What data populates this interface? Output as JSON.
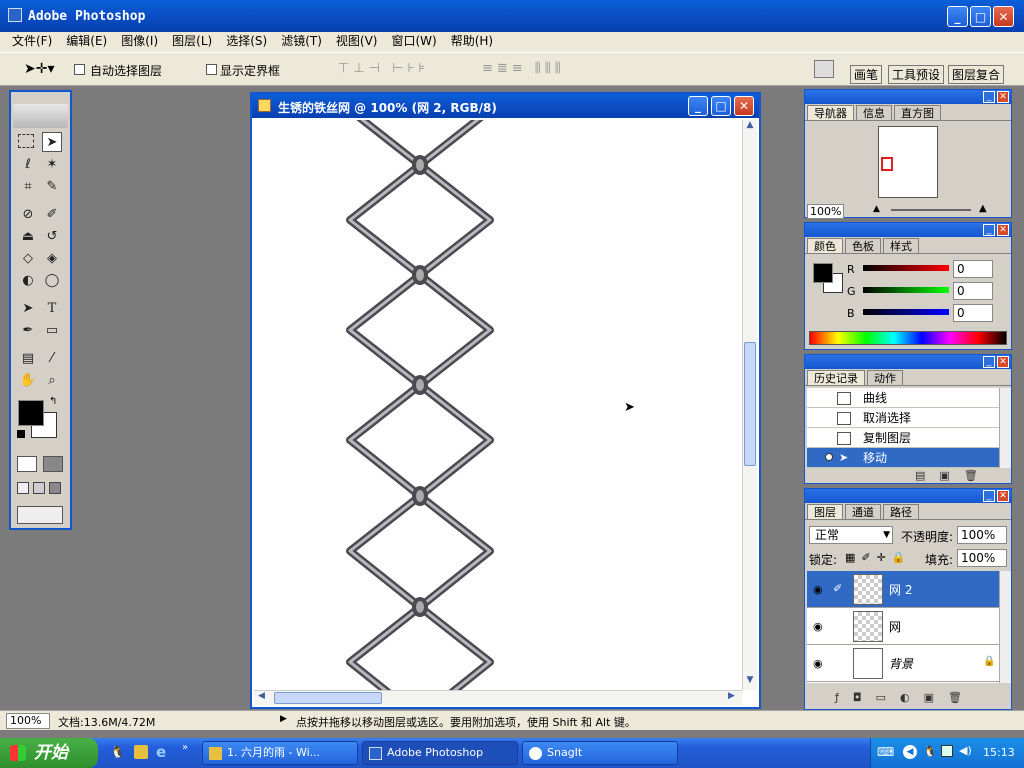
{
  "app": {
    "title": "Adobe Photoshop"
  },
  "menu": [
    "文件(F)",
    "编辑(E)",
    "图像(I)",
    "图层(L)",
    "选择(S)",
    "滤镜(T)",
    "视图(V)",
    "窗口(W)",
    "帮助(H)"
  ],
  "options": {
    "auto_select_label": "自动选择图层",
    "show_bounds_label": "显示定界框",
    "palette_tabs": [
      "画笔",
      "工具预设",
      "图层复合"
    ]
  },
  "document": {
    "title": "生锈的铁丝网 @ 100% (网 2, RGB/8)"
  },
  "navigator": {
    "tabs": [
      "导航器",
      "信息",
      "直方图"
    ],
    "zoom": "100%"
  },
  "color": {
    "tabs": [
      "颜色",
      "色板",
      "样式"
    ],
    "r_label": "R",
    "g_label": "G",
    "b_label": "B",
    "r": "0",
    "g": "0",
    "b": "0"
  },
  "history": {
    "tabs": [
      "历史记录",
      "动作"
    ],
    "items": [
      "曲线",
      "取消选择",
      "复制图层",
      "移动"
    ]
  },
  "layers": {
    "tabs": [
      "图层",
      "通道",
      "路径"
    ],
    "blend_mode": "正常",
    "opacity_label": "不透明度:",
    "opacity": "100%",
    "lock_label": "锁定:",
    "fill_label": "填充:",
    "fill": "100%",
    "items": [
      "网 2",
      "网",
      "背景"
    ]
  },
  "status": {
    "zoom": "100%",
    "doc_info": "文档:13.6M/4.72M",
    "hint": "点按并拖移以移动图层或选区。要用附加选项，使用 Shift 和 Alt 键。"
  },
  "taskbar": {
    "start": "开始",
    "tasks": [
      "1. 六月的雨 - Wi...",
      "Adobe Photoshop",
      "SnagIt"
    ],
    "clock": "15:13"
  },
  "colors": {
    "accent": "#316ac5",
    "titlebar": "#0b4fc7",
    "panel_bg": "#d4d0c8"
  }
}
